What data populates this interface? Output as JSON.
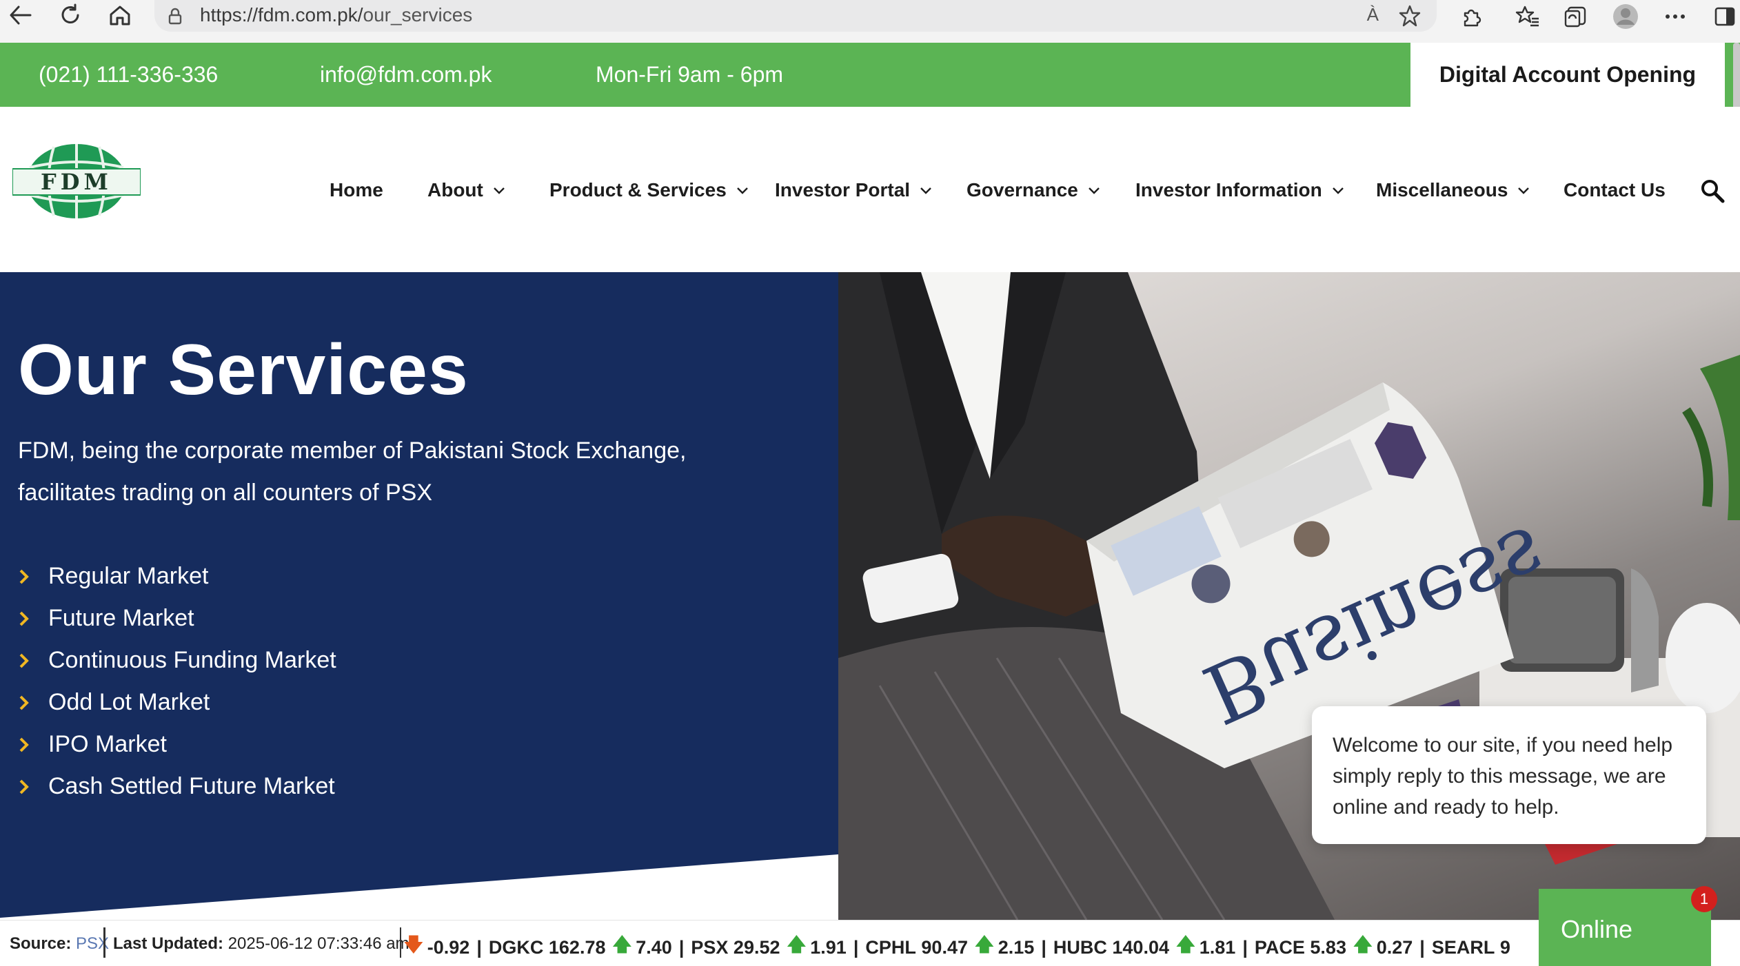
{
  "browser": {
    "url_host": "https://fdm.com.pk/",
    "url_path": "our_services",
    "read_aloud": "À"
  },
  "topbar": {
    "phone": "(021) 111-336-336",
    "email": "info@fdm.com.pk",
    "hours": "Mon-Fri 9am - 6pm",
    "cta": "Digital Account Opening"
  },
  "logo": {
    "text": "FDM"
  },
  "nav": {
    "items": [
      {
        "label": "Home",
        "dropdown": false
      },
      {
        "label": "About",
        "dropdown": true
      },
      {
        "label": "Product & Services",
        "dropdown": true
      },
      {
        "label": "Investor Portal",
        "dropdown": true
      },
      {
        "label": "Governance",
        "dropdown": true
      },
      {
        "label": "Investor Information",
        "dropdown": true
      },
      {
        "label": "Miscellaneous",
        "dropdown": true
      },
      {
        "label": "Contact Us",
        "dropdown": false
      }
    ]
  },
  "hero": {
    "title": "Our Services",
    "description_line1": "FDM, being the corporate member of Pakistani Stock Exchange,",
    "description_line2": "facilitates trading on all counters of PSX",
    "services": [
      "Regular Market",
      "Future Market",
      "Continuous Funding Market",
      "Odd Lot Market",
      "IPO Market",
      "Cash Settled Future Market"
    ],
    "newspaper_headline": "Business"
  },
  "chat": {
    "message": "Welcome to our site, if you need help simply reply to this message, we are online and ready to help.",
    "status": "Online",
    "unread": "1"
  },
  "ticker": {
    "source_label": "Source:",
    "source_value": "PSX",
    "updated_label": "Last Updated:",
    "updated_value": "2025-06-12 07:33:46 am",
    "lead_change": "-0.92",
    "quotes": [
      {
        "symbol": "DGKC",
        "price": "162.78",
        "change": "7.40",
        "direction": "up"
      },
      {
        "symbol": "PSX",
        "price": "29.52",
        "change": "1.91",
        "direction": "up"
      },
      {
        "symbol": "CPHL",
        "price": "90.47",
        "change": "2.15",
        "direction": "up"
      },
      {
        "symbol": "HUBC",
        "price": "140.04",
        "change": "1.81",
        "direction": "up"
      },
      {
        "symbol": "PACE",
        "price": "5.83",
        "change": "0.27",
        "direction": "up"
      },
      {
        "symbol": "SEARL",
        "price": "9",
        "change": "",
        "direction": "up"
      }
    ]
  },
  "colors": {
    "brand_green": "#5bb454",
    "hero_navy": "#162c5e",
    "up_arrow": "#38a93a",
    "down_arrow": "#e4581b",
    "bullet": "#f0b722"
  }
}
